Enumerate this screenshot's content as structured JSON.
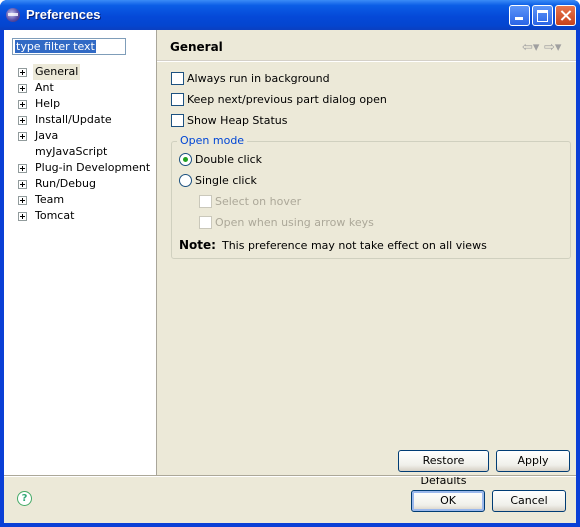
{
  "window": {
    "title": "Preferences"
  },
  "filter": {
    "value": "type filter text"
  },
  "tree": {
    "items": [
      {
        "label": "General",
        "expandable": true,
        "selected": true
      },
      {
        "label": "Ant",
        "expandable": true
      },
      {
        "label": "Help",
        "expandable": true
      },
      {
        "label": "Install/Update",
        "expandable": true
      },
      {
        "label": "Java",
        "expandable": true
      },
      {
        "label": "myJavaScript",
        "expandable": false
      },
      {
        "label": "Plug-in Development",
        "expandable": true
      },
      {
        "label": "Run/Debug",
        "expandable": true
      },
      {
        "label": "Team",
        "expandable": true
      },
      {
        "label": "Tomcat",
        "expandable": true
      }
    ]
  },
  "page": {
    "title": "General",
    "options": {
      "always_run": "Always run in background",
      "keep_dialog": "Keep next/previous part dialog open",
      "show_heap": "Show Heap Status"
    },
    "open_mode": {
      "title": "Open mode",
      "double_click": "Double click",
      "single_click": "Single click",
      "select_on_hover": "Select on hover",
      "open_arrow_keys": "Open when using arrow keys",
      "selected": "double_click"
    },
    "note": {
      "label": "Note:",
      "text": "This preference may not take effect on all views"
    }
  },
  "buttons": {
    "restore_defaults": "Restore Defaults",
    "apply": "Apply",
    "ok": "OK",
    "cancel": "Cancel"
  },
  "icons": {
    "back": "back-arrow-icon",
    "forward": "forward-arrow-icon",
    "help": "help-icon"
  }
}
